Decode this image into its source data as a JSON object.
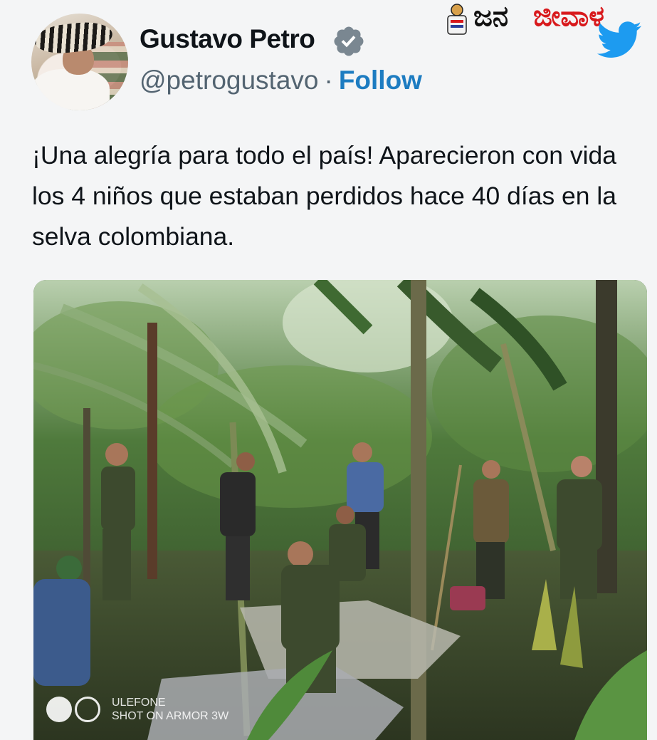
{
  "tweet": {
    "author_name": "Gustavo Petro",
    "author_handle": "@petrogustavo",
    "separator": "·",
    "follow_label": "Follow",
    "text": "¡Una alegría para todo el país! Aparecieron con vida los 4 niños que estaban perdidos hace 40 días en la selva colombiana."
  },
  "watermark": {
    "part1": "ಜನ",
    "part2": "ಜೀವಾಳ"
  },
  "photo": {
    "camera_brand": "ULEFONE",
    "camera_caption": "SHOT ON ARMOR 3W"
  },
  "colors": {
    "follow": "#1d7cc1",
    "verified": "#7a8791",
    "twitter_blue": "#1d9bf0",
    "watermark_red": "#d8191c"
  },
  "icons": [
    "verified-badge-icon",
    "twitter-bird-icon",
    "watermark-logo-icon"
  ]
}
